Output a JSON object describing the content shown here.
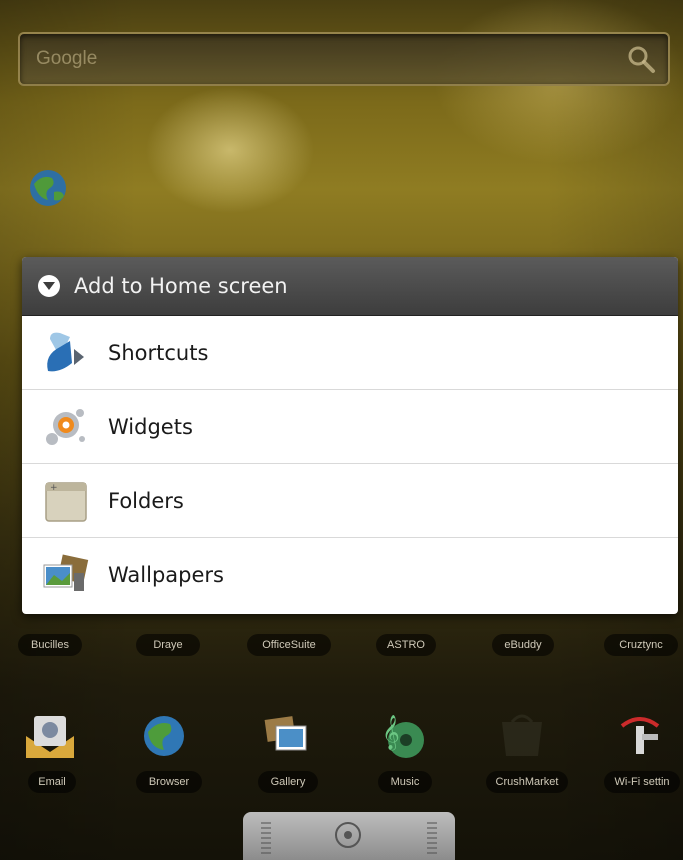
{
  "search": {
    "placeholder": "Google"
  },
  "dialog": {
    "title": "Add to Home screen",
    "items": [
      {
        "label": "Shortcuts",
        "icon": "shortcuts-icon"
      },
      {
        "label": "Widgets",
        "icon": "widgets-icon"
      },
      {
        "label": "Folders",
        "icon": "folder-icon"
      },
      {
        "label": "Wallpapers",
        "icon": "wallpapers-icon"
      }
    ]
  },
  "apps_row1": [
    {
      "label": "Bucilles"
    },
    {
      "label": "Draye"
    },
    {
      "label": "OfficeSuite"
    },
    {
      "label": "ASTRO"
    },
    {
      "label": "eBuddy"
    },
    {
      "label": "Cruztync"
    }
  ],
  "apps_row2": [
    {
      "label": "Email",
      "icon": "email-icon"
    },
    {
      "label": "Browser",
      "icon": "browser-icon"
    },
    {
      "label": "Gallery",
      "icon": "gallery-icon"
    },
    {
      "label": "Music",
      "icon": "music-icon"
    },
    {
      "label": "CrushMarket",
      "icon": "market-icon"
    },
    {
      "label": "Wi-Fi settin",
      "icon": "wifi-settings-icon"
    }
  ],
  "colors": {
    "dialog_header": "#3d3d3d",
    "dialog_bg": "#ffffff",
    "wallpaper": "#7c6a1a"
  }
}
